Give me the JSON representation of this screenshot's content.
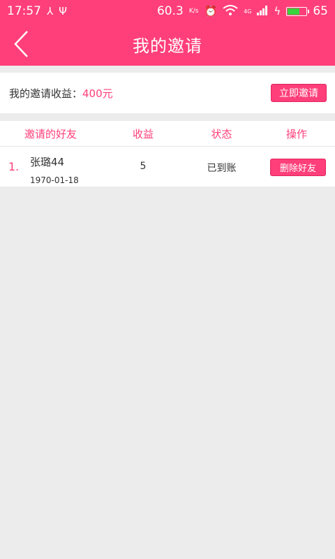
{
  "status_bar": {
    "time": "17:57",
    "speed": "60.3",
    "speed_unit": "K/s",
    "network": "4G",
    "battery": "65",
    "battery_level": 0.65
  },
  "header": {
    "title": "我的邀请"
  },
  "earnings": {
    "label": "我的邀请收益：",
    "value": "400元",
    "invite_button": "立即邀请"
  },
  "table": {
    "columns": [
      "邀请的好友",
      "收益",
      "状态",
      "操作"
    ],
    "rows": [
      {
        "index": "1.",
        "name": "张璐44",
        "date": "1970-01-18",
        "earning": "5",
        "status": "已到账",
        "action": "删除好友"
      }
    ]
  },
  "colors": {
    "accent": "#ff3f7a",
    "background": "#ececec"
  }
}
